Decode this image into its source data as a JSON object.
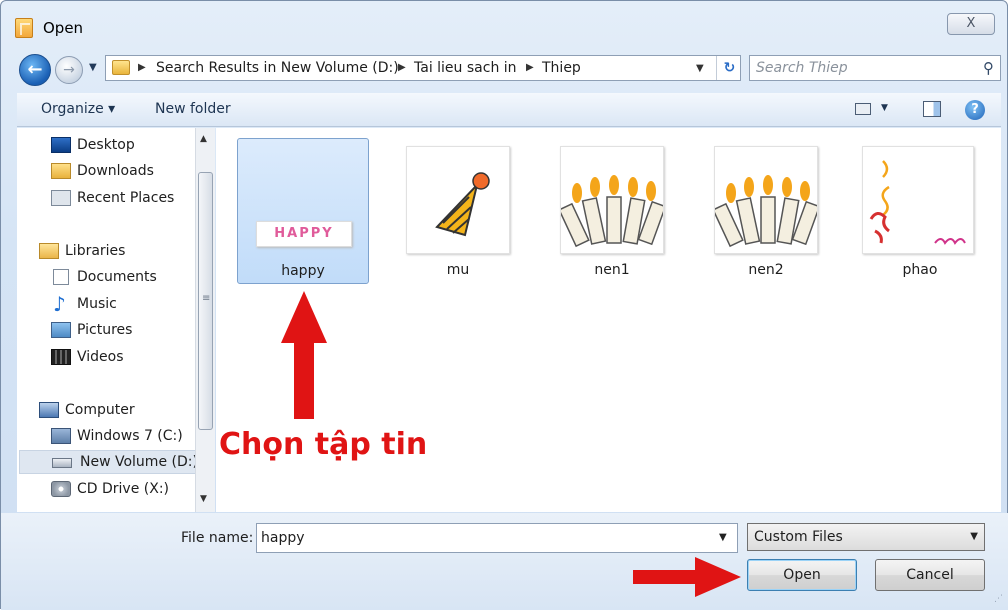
{
  "window": {
    "title": "Open",
    "close_label": "X"
  },
  "address": {
    "crumbs": [
      "Search Results in New Volume (D:)",
      "Tai lieu sach in",
      "Thiep"
    ]
  },
  "search": {
    "placeholder": "Search Thiep"
  },
  "toolbar": {
    "organize_label": "Organize ▾",
    "new_folder_label": "New folder",
    "help_label": "?"
  },
  "sidebar": {
    "favorites": [
      "Desktop",
      "Downloads",
      "Recent Places"
    ],
    "libraries_label": "Libraries",
    "libraries": [
      "Documents",
      "Music",
      "Pictures",
      "Videos"
    ],
    "computer_label": "Computer",
    "drives": [
      "Windows 7 (C:)",
      "New Volume (D:)",
      "CD Drive (X:)"
    ],
    "selected": "New Volume (D:)"
  },
  "files": [
    {
      "name": "happy",
      "selected": true
    },
    {
      "name": "mu",
      "selected": false
    },
    {
      "name": "nen1",
      "selected": false
    },
    {
      "name": "nen2",
      "selected": false
    },
    {
      "name": "phao",
      "selected": false
    }
  ],
  "thumb_text": {
    "happy": "HAPPY"
  },
  "footer": {
    "file_name_label": "File name:",
    "file_name_value": "happy",
    "file_type": "Custom Files",
    "open_label": "Open",
    "cancel_label": "Cancel"
  },
  "annotation": {
    "text": "Chọn tập tin",
    "color": "#e01414"
  }
}
